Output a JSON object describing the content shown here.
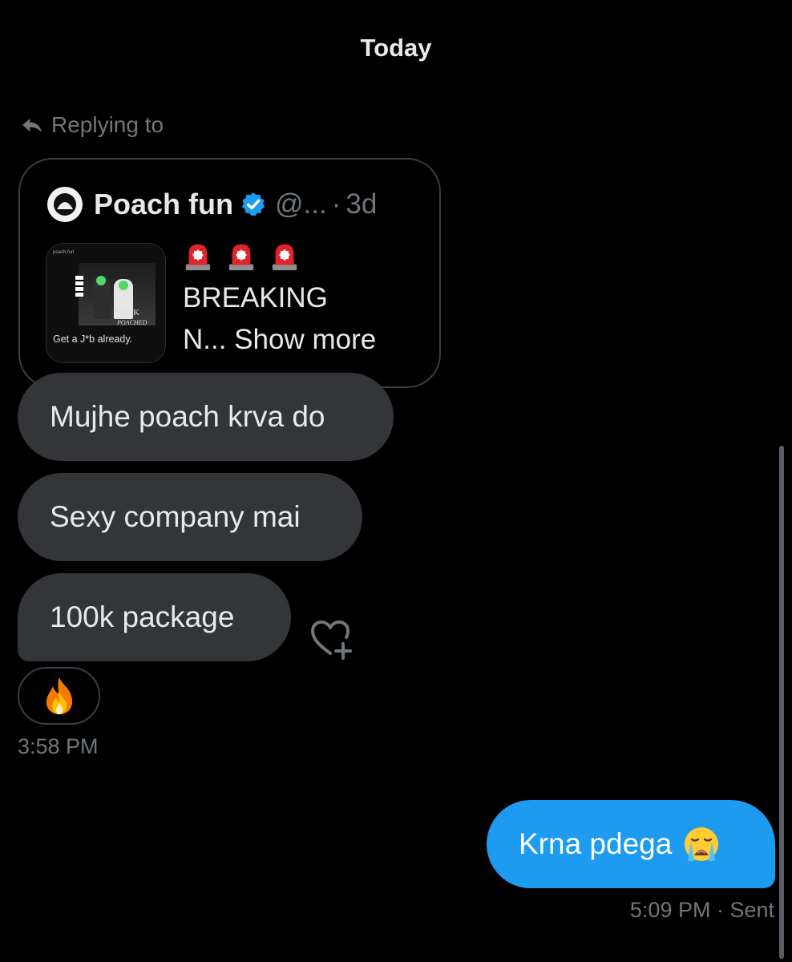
{
  "conversation": {
    "date_header": "Today",
    "reply_context": {
      "label": "Replying to",
      "icon": "reply-arrow-icon"
    },
    "quoted_post": {
      "author_name": "Poach fun",
      "verified": true,
      "handle": "@...",
      "separator": "·",
      "age": "3d",
      "text_line1": "BREAKING",
      "text_line2": "N... Show more",
      "emoji": [
        "police-car-light",
        "police-car-light",
        "police-car-light"
      ],
      "thumbnail": {
        "amount": "$203K",
        "caption": "POACHED",
        "tagline": "Get a J*b already."
      }
    },
    "messages_in": [
      {
        "text": "Mujhe poach krva do"
      },
      {
        "text": "Sexy company mai"
      },
      {
        "text": "100k package"
      }
    ],
    "reaction": {
      "emoji": "fire"
    },
    "time_in": "3:58 PM",
    "message_out": {
      "text": "Krna pdega",
      "emoji": "loudly-crying-face"
    },
    "status_out": "5:09 PM · Sent"
  },
  "colors": {
    "background": "#000000",
    "bubble_in": "#333539",
    "bubble_out": "#1d9bf0",
    "muted_text": "#71767b",
    "verified_badge": "#1d9bf0"
  }
}
